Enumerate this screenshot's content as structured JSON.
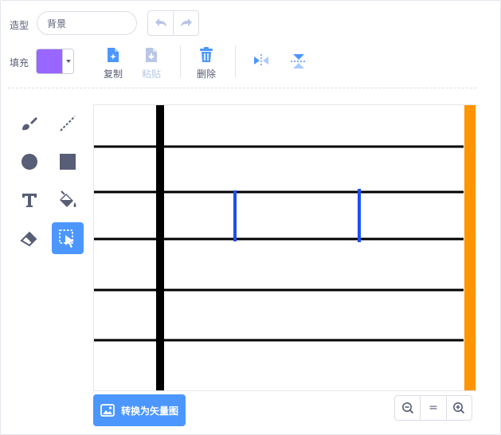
{
  "header": {
    "costume_label": "造型",
    "costume_name": "背景",
    "fill_label": "填充",
    "fill_color": "#9966ff"
  },
  "toolbar": {
    "copy_label": "复制",
    "paste_label": "粘贴",
    "delete_label": "删除"
  },
  "bottom": {
    "convert_label": "转换为矢量图",
    "zoom_reset_label": "="
  },
  "colors": {
    "accent": "#4c97ff",
    "text": "#575e75",
    "disabled": "#b8c7e6",
    "canvas_border_stripe": "#ff9500",
    "blue_marks": "#1d4ff0"
  },
  "tools": [
    "brush-icon",
    "line-icon",
    "circle-icon",
    "rectangle-icon",
    "text-icon",
    "fill-icon",
    "eraser-icon",
    "select-icon"
  ],
  "selected_tool": "select-icon"
}
